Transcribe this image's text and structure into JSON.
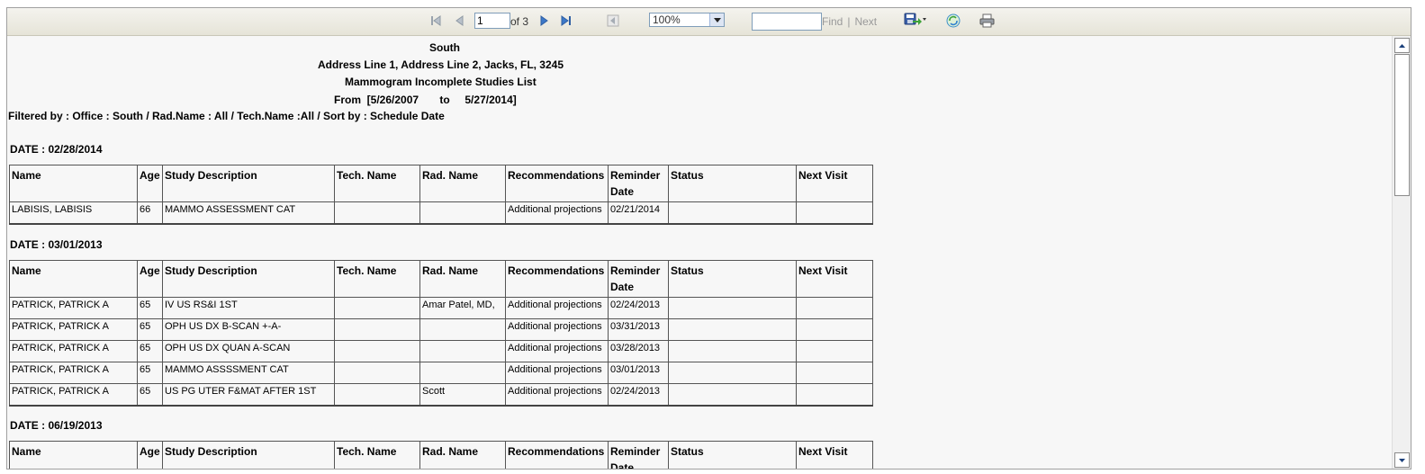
{
  "toolbar": {
    "page_current": "1",
    "page_of": "of 3",
    "zoom": "100%",
    "find_label": "Find",
    "find_separator": "|",
    "next_label": "Next",
    "find_value": ""
  },
  "report": {
    "office_title": "South",
    "address": "Address Line 1, Address Line 2, Jacks, FL, 3245",
    "report_title": "Mammogram Incomplete Studies List",
    "date_range": "From  [5/26/2007       to     5/27/2014]",
    "filter_line": "Filtered by : Office : South  /  Rad.Name : All  /  Tech.Name :All  /  Sort by : Schedule Date"
  },
  "columns": [
    "Name",
    "Age",
    "Study Description",
    "Tech. Name",
    "Rad. Name",
    "Recommendations",
    "Reminder Date",
    "Status",
    "Next Visit"
  ],
  "groups": [
    {
      "date_label": "DATE :  02/28/2014",
      "rows": [
        [
          "LABISIS, LABISIS",
          "66",
          "MAMMO ASSESSMENT CAT",
          "",
          "",
          "Additional projections",
          "02/21/2014",
          "",
          ""
        ]
      ]
    },
    {
      "date_label": "DATE :  03/01/2013",
      "rows": [
        [
          "PATRICK, PATRICK A",
          "65",
          "IV US RS&I 1ST",
          "",
          "Amar Patel, MD,",
          "Additional projections",
          "02/24/2013",
          "",
          ""
        ],
        [
          "PATRICK, PATRICK A",
          "65",
          "OPH US DX B-SCAN +-A-",
          "",
          "",
          "Additional projections",
          "03/31/2013",
          "",
          ""
        ],
        [
          "PATRICK, PATRICK A",
          "65",
          "OPH US DX QUAN A-SCAN",
          "",
          "",
          "Additional projections",
          "03/28/2013",
          "",
          ""
        ],
        [
          "PATRICK, PATRICK A",
          "65",
          "MAMMO ASSSSMENT CAT",
          "",
          "",
          "Additional projections",
          "03/01/2013",
          "",
          ""
        ],
        [
          "PATRICK, PATRICK A",
          "65",
          "US PG UTER F&MAT AFTER 1ST",
          "",
          "Scott",
          "Additional projections",
          "02/24/2013",
          "",
          ""
        ]
      ]
    },
    {
      "date_label": "DATE :  06/19/2013",
      "rows": []
    }
  ],
  "icons": {
    "first_page": "first-page-icon",
    "prev_page": "prev-page-icon",
    "next_page": "next-page-icon",
    "last_page": "last-page-icon",
    "back": "back-to-parent-icon",
    "export": "export-save-icon",
    "refresh": "refresh-icon",
    "print": "print-icon"
  }
}
